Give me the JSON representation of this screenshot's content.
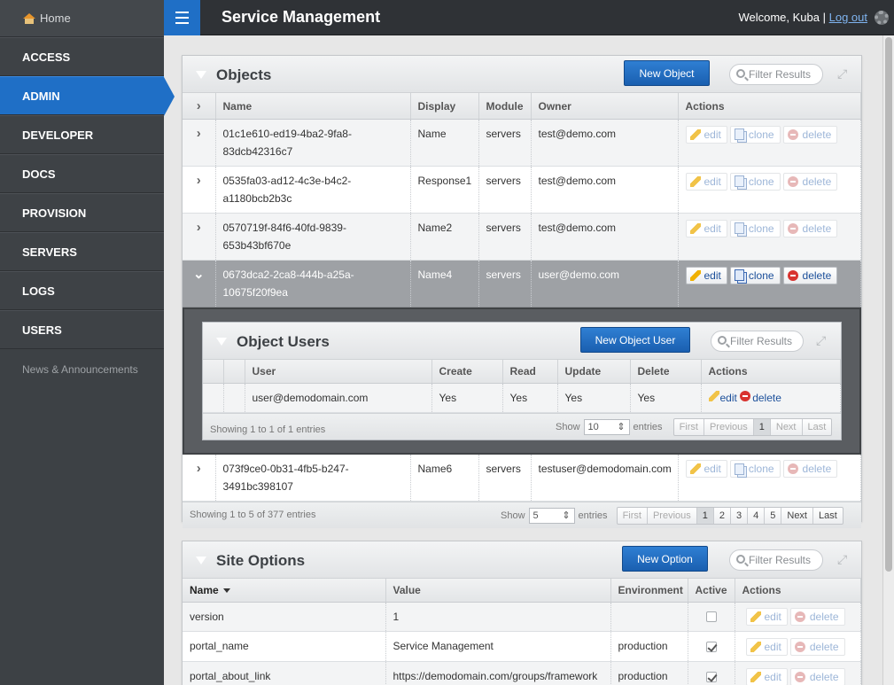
{
  "sidebar": {
    "home_label": "Home",
    "items": [
      {
        "label": "ACCESS",
        "active": false
      },
      {
        "label": "ADMIN",
        "active": true
      },
      {
        "label": "DEVELOPER",
        "active": false
      },
      {
        "label": "DOCS",
        "active": false
      },
      {
        "label": "PROVISION",
        "active": false
      },
      {
        "label": "SERVERS",
        "active": false
      },
      {
        "label": "LOGS",
        "active": false
      },
      {
        "label": "USERS",
        "active": false
      }
    ],
    "news_label": "News & Announcements"
  },
  "header": {
    "title": "Service Management",
    "welcome_text": "Welcome, Kuba",
    "separator": "|",
    "logout_label": "Log out",
    "accent_color": "#1f6fc6"
  },
  "objects": {
    "title": "Objects",
    "new_button": "New Object",
    "filter_placeholder": "Filter Results",
    "columns": [
      "Name",
      "Display",
      "Module",
      "Owner",
      "Actions"
    ],
    "rows": [
      {
        "name_line1": "01c1e610-ed19-4ba2-9fa8-",
        "name_line2": "83dcb42316c7",
        "display": "Name",
        "module": "servers",
        "owner": "test@demo.com"
      },
      {
        "name_line1": "0535fa03-ad12-4c3e-b4c2-",
        "name_line2": "a1180bcb2b3c",
        "display": "Response1",
        "module": "servers",
        "owner": "test@demo.com"
      },
      {
        "name_line1": "0570719f-84f6-40fd-9839-",
        "name_line2": "653b43bf670e",
        "display": "Name2",
        "module": "servers",
        "owner": "test@demo.com"
      },
      {
        "name_line1": "0673dca2-2ca8-444b-a25a-",
        "name_line2": "10675f20f9ea",
        "display": "Name4",
        "module": "servers",
        "owner": "user@demo.com"
      },
      {
        "name_line1": "073f9ce0-0b31-4fb5-b247-",
        "name_line2": "3491bc398107",
        "display": "Name6",
        "module": "servers",
        "owner": "testuser@demodomain.com"
      }
    ],
    "action_edit": "edit",
    "action_clone": "clone",
    "action_delete": "delete",
    "footer_info": "Showing 1 to 5 of 377 entries",
    "show_label": "Show",
    "page_size": "5",
    "entries_label": "entries",
    "pager": {
      "first": "First",
      "previous": "Previous",
      "pages": [
        "1",
        "2",
        "3",
        "4",
        "5"
      ],
      "next": "Next",
      "last": "Last"
    }
  },
  "object_users": {
    "title": "Object Users",
    "new_button": "New Object User",
    "filter_placeholder": "Filter Results",
    "columns": [
      "User",
      "Create",
      "Read",
      "Update",
      "Delete",
      "Actions"
    ],
    "row": {
      "user": "user@demodomain.com",
      "create": "Yes",
      "read": "Yes",
      "update": "Yes",
      "delete": "Yes"
    },
    "action_edit": "edit",
    "action_delete": "delete",
    "footer_info": "Showing 1 to 1 of 1 entries",
    "show_label": "Show",
    "page_size": "10",
    "entries_label": "entries",
    "pager": {
      "first": "First",
      "previous": "Previous",
      "page": "1",
      "next": "Next",
      "last": "Last"
    }
  },
  "site_options": {
    "title": "Site Options",
    "new_button": "New Option",
    "filter_placeholder": "Filter Results",
    "columns": [
      "Name",
      "Value",
      "Environment",
      "Active",
      "Actions"
    ],
    "rows": [
      {
        "name": "version",
        "value": "1",
        "environment": "",
        "active": false
      },
      {
        "name": "portal_name",
        "value": "Service Management",
        "environment": "production",
        "active": true
      },
      {
        "name": "portal_about_link",
        "value": "https://demodomain.com/groups/framework",
        "environment": "production",
        "active": true
      }
    ],
    "action_edit": "edit",
    "action_delete": "delete"
  }
}
